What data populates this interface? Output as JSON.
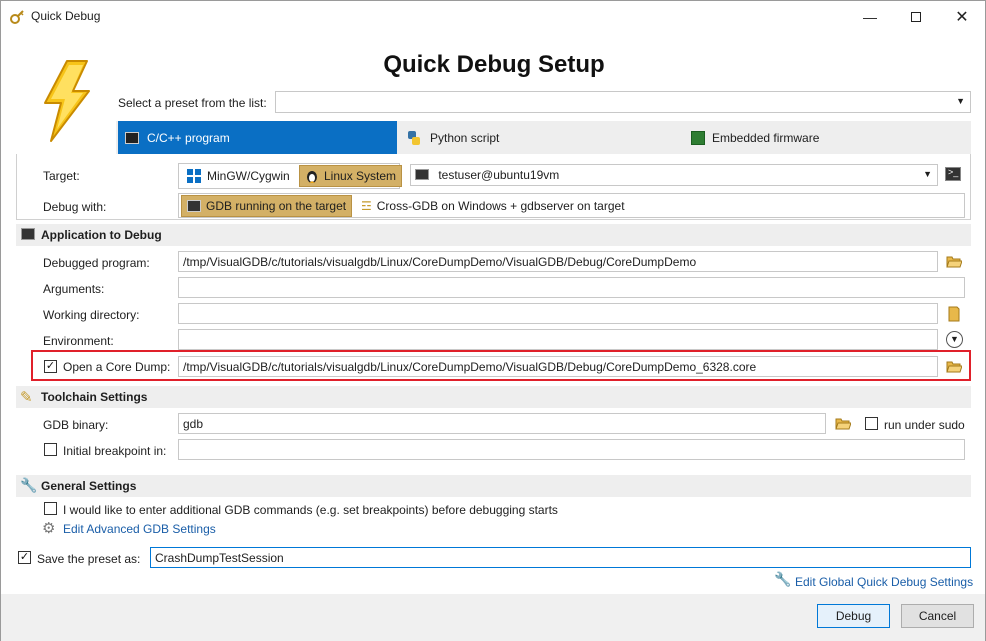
{
  "window": {
    "title": "Quick Debug"
  },
  "header": {
    "title": "Quick Debug Setup"
  },
  "preset": {
    "label": "Select a preset from the list:",
    "value": ""
  },
  "tabs": [
    {
      "label": "C/C++ program",
      "active": true
    },
    {
      "label": "Python script",
      "active": false
    },
    {
      "label": "Embedded firmware",
      "active": false
    }
  ],
  "target": {
    "label": "Target:",
    "options": [
      "MinGW/Cygwin",
      "Linux System"
    ],
    "selected": "Linux System",
    "machine": "testuser@ubuntu19vm"
  },
  "debug_with": {
    "label": "Debug with:",
    "options": [
      "GDB running on the target",
      "Cross-GDB on Windows + gdbserver on target"
    ],
    "selected": "GDB running on the target"
  },
  "app": {
    "section_title": "Application to Debug",
    "program_label": "Debugged program:",
    "program_value": "/tmp/VisualGDB/c/tutorials/visualgdb/Linux/CoreDumpDemo/VisualGDB/Debug/CoreDumpDemo",
    "arguments_label": "Arguments:",
    "arguments_value": "",
    "workdir_label": "Working directory:",
    "workdir_value": "",
    "env_label": "Environment:",
    "env_value": "",
    "core_label": "Open a Core Dump:",
    "core_checked": true,
    "core_value": "/tmp/VisualGDB/c/tutorials/visualgdb/Linux/CoreDumpDemo/VisualGDB/Debug/CoreDumpDemo_6328.core"
  },
  "toolchain": {
    "section_title": "Toolchain Settings",
    "gdb_label": "GDB binary:",
    "gdb_value": "gdb",
    "sudo_label": "run under sudo",
    "sudo_checked": false,
    "bp_label": "Initial breakpoint in:",
    "bp_checked": false,
    "bp_value": ""
  },
  "general": {
    "section_title": "General Settings",
    "extra_label": "I would like to enter additional GDB commands (e.g. set breakpoints) before debugging starts",
    "extra_checked": false,
    "advanced_link": "Edit Advanced GDB Settings"
  },
  "save": {
    "label": "Save the preset as:",
    "checked": true,
    "value": "CrashDumpTestSession"
  },
  "global_link": "Edit Global Quick Debug Settings",
  "buttons": {
    "debug": "Debug",
    "cancel": "Cancel"
  },
  "colors": {
    "accent": "#0a6fc4",
    "highlight_border": "#e0202a",
    "toggle_on": "#d3b066"
  }
}
